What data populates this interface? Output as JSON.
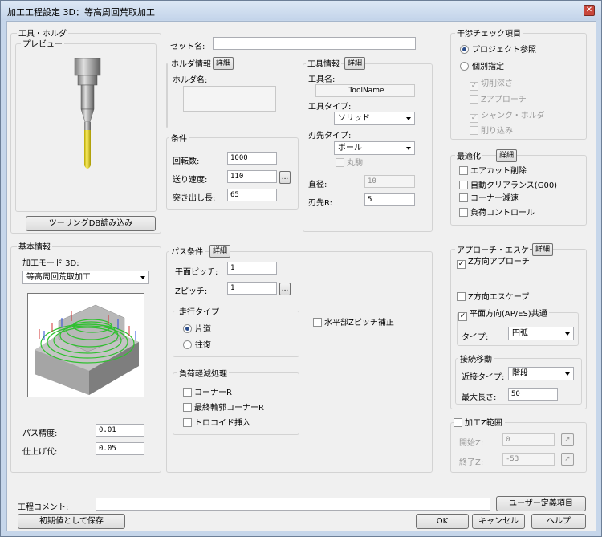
{
  "title": "加工工程設定 3D：等高周回荒取加工",
  "tool_holder": {
    "group": "工具・ホルダ",
    "preview": "プレビュー",
    "tooling_btn": "ツーリングDB読み込み"
  },
  "set": {
    "label": "セット名:",
    "value": ""
  },
  "holder_info": {
    "group": "ホルダ情報",
    "detail": "詳細",
    "name_label": "ホルダ名:"
  },
  "conditions": {
    "group": "条件",
    "rpm_label": "回転数:",
    "rpm": "1000",
    "feed_label": "送り速度:",
    "feed": "110",
    "stickout_label": "突き出し長:",
    "stickout": "65",
    "browse": "..."
  },
  "tool_info": {
    "group": "工具情報",
    "detail": "詳細",
    "name_label": "工具名:",
    "name": "ToolName",
    "type_label": "工具タイプ:",
    "type": "ソリッド",
    "tip_label": "刃先タイプ:",
    "tip": "ボール",
    "round_label": "丸駒",
    "dia_label": "直径:",
    "dia": "10",
    "tipr_label": "刃先R:",
    "tipr": "5"
  },
  "interference": {
    "group": "干渉チェック項目",
    "radio1": "プロジェクト参照",
    "radio2": "個別指定",
    "c1": "切削深さ",
    "c2": "Zアプローチ",
    "c3": "シャンク・ホルダ",
    "c4": "削り込み",
    "check": "✓"
  },
  "optimize": {
    "group": "最適化",
    "detail": "詳細",
    "o1": "エアカット削除",
    "o2": "自動クリアランス(G00)",
    "o3": "コーナー減速",
    "o4": "負荷コントロール"
  },
  "basic": {
    "group": "基本情報",
    "mode_label": "加工モード 3D:",
    "mode": "等高周回荒取加工",
    "accuracy_label": "パス精度:",
    "accuracy": "0.01",
    "allowance_label": "仕上げ代:",
    "allowance": "0.05"
  },
  "path": {
    "group": "パス条件",
    "detail": "詳細",
    "pitch_label": "平面ピッチ:",
    "pitch": "1",
    "zpitch_label": "Zピッチ:",
    "zpitch": "1",
    "browse": "...",
    "travel_group": "走行タイプ",
    "oneway": "片道",
    "roundtrip": "往復",
    "horizontal": "水平部Zピッチ補正",
    "load_group": "負荷軽減処理",
    "l1": "コーナーR",
    "l2": "最終輪郭コーナーR",
    "l3": "トロコイド挿入"
  },
  "approach": {
    "group": "アプローチ・エスケープ",
    "detail": "詳細",
    "z_approach": "Z方向アプローチ",
    "z_escape": "Z方向エスケープ",
    "plane": "平面方向(AP/ES)共通",
    "type_label": "タイプ:",
    "type": "円弧",
    "conn_group": "接続移動",
    "conn_type_label": "近接タイプ:",
    "conn_type": "階段",
    "max_label": "最大長さ:",
    "max": "50",
    "check": "✓"
  },
  "zrange": {
    "group": "加工Z範囲",
    "start_label": "開始Z:",
    "start": "0",
    "end_label": "終了Z:",
    "end": "-53"
  },
  "footer": {
    "comment_label": "工程コメント:",
    "comment": "",
    "user_btn": "ユーザー定義項目",
    "save_default": "初期値として保存",
    "ok": "OK",
    "cancel": "キャンセル",
    "help": "ヘルプ"
  }
}
